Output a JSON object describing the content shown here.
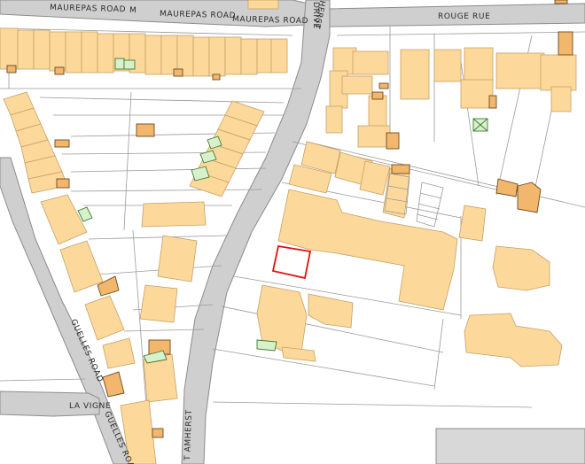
{
  "map": {
    "roads": {
      "maurepas_road_1": "MAUREPAS ROAD",
      "maurepas_road_m": "M",
      "maurepas_road_2": "MAUREPAS ROAD",
      "maurepas_road_3": "MAUREPAS ROAD",
      "rouge_rue": "ROUGE RUE",
      "amherst_drive": "AMHERST",
      "drive_fragment": "DRIVE",
      "guelles_road_1": "GUELLES ROAD",
      "guelles_road_2": "GUELLES ROAD",
      "la_vigne": "LA VIGNE",
      "mount_amherst": "T AMHERST"
    },
    "colors": {
      "building_fill": "#fcd99b",
      "building_stroke": "#c6a067",
      "outbuilding_fill": "#f2b66d",
      "outbuilding_stroke": "#6b4a1e",
      "glasshouse_fill": "#d7f1cc",
      "glasshouse_stroke": "#3f7a32",
      "road_fill": "#cfcfcf",
      "road_stroke": "#8c8c8c",
      "highlight": "#e01010",
      "parcel_line": "#9a9a9a"
    },
    "highlighted_plot": "site-boundary"
  }
}
